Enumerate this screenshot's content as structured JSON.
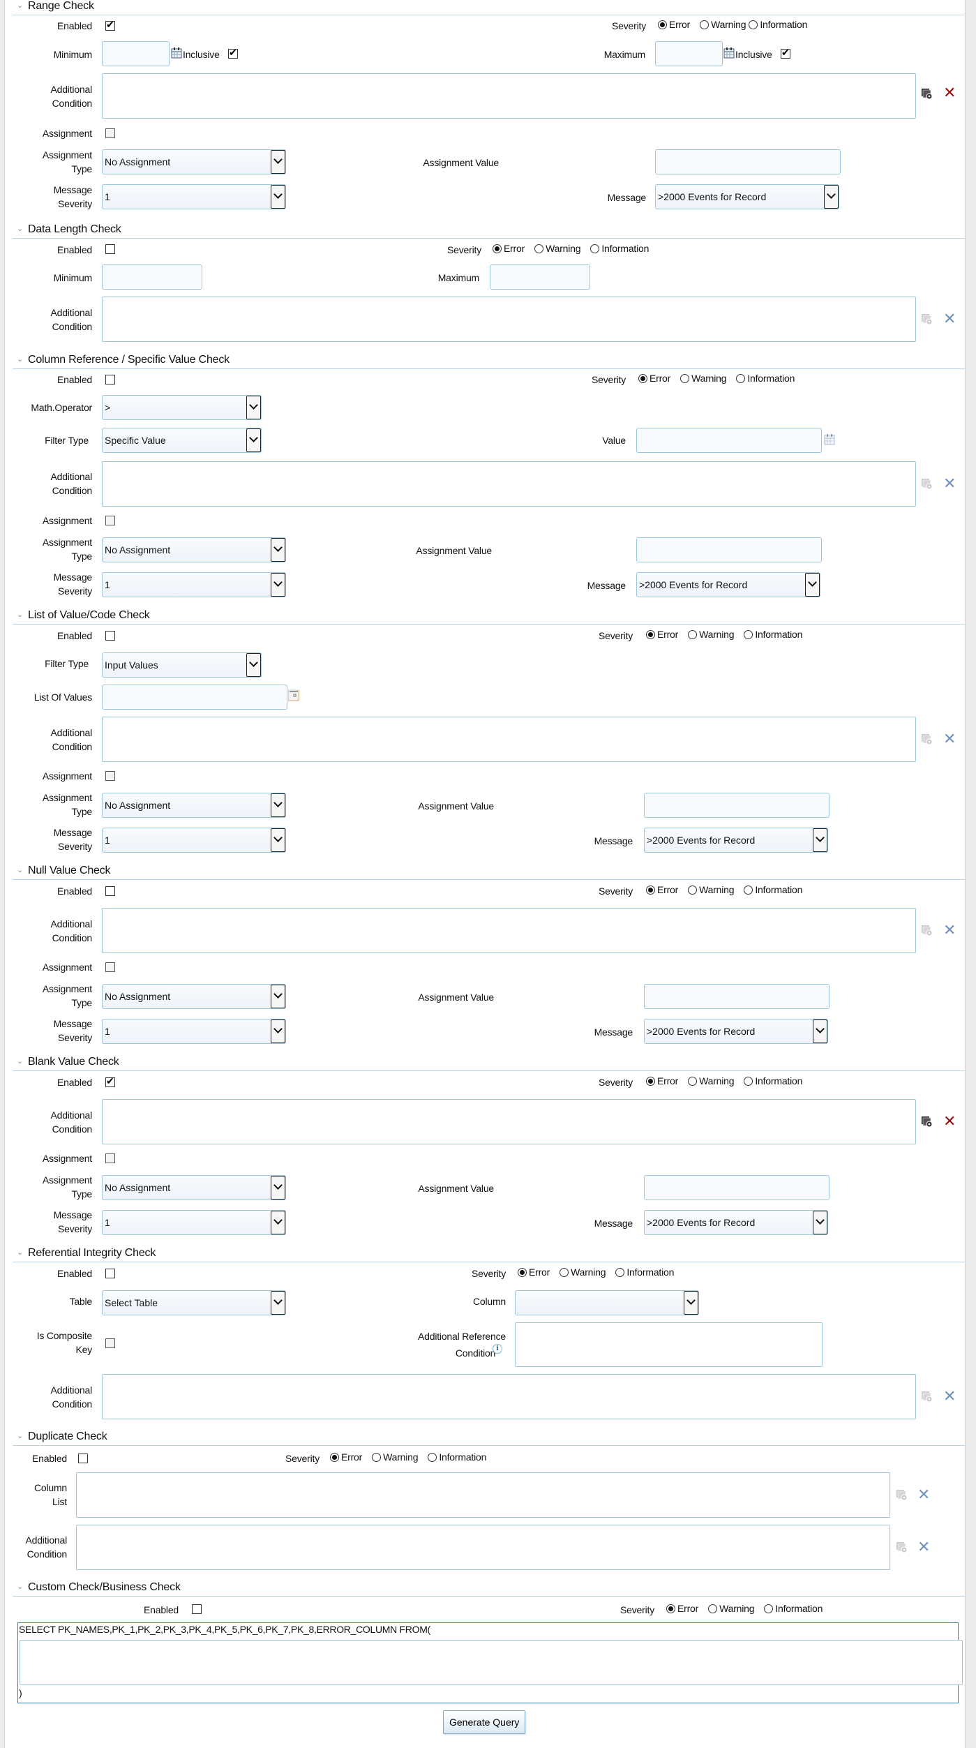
{
  "common": {
    "enabled": "Enabled",
    "severity": "Severity",
    "sev_error": "Error",
    "sev_warning": "Warning",
    "sev_information": "Information",
    "minimum": "Minimum",
    "maximum": "Maximum",
    "inclusive": "Inclusive",
    "additional": "Additional",
    "condition": "Condition",
    "assignment": "Assignment",
    "assignment_type_1": "Assignment",
    "assignment_type_2": "Type",
    "assignment_value": "Assignment Value",
    "message_severity_1": "Message",
    "message_severity_2": "Severity",
    "message": "Message",
    "no_assignment": "No Assignment",
    "msg_severity_val": "1",
    "message_val": ">2000 Events for Record"
  },
  "sections": {
    "range": {
      "title": "Range Check",
      "enabled": true,
      "severity": "Error",
      "min_inclusive": true,
      "max_inclusive": true,
      "assignment": false
    },
    "data_length": {
      "title": "Data Length Check",
      "enabled": false,
      "severity": "Error"
    },
    "column_ref": {
      "title": "Column Reference / Specific Value Check",
      "enabled": false,
      "severity": "Error",
      "math_operator_label": "Math.Operator",
      "math_operator_val": ">",
      "filter_type_label": "Filter Type",
      "filter_type_val": "Specific Value",
      "value_label": "Value",
      "assignment": false
    },
    "lov": {
      "title": "List of Value/Code Check",
      "enabled": false,
      "severity": "Error",
      "filter_type_label": "Filter Type",
      "filter_type_val": "Input Values",
      "lov_label": "List Of Values",
      "assignment": false
    },
    "null_value": {
      "title": "Null Value Check",
      "enabled": false,
      "severity": "Error",
      "assignment": false
    },
    "blank_value": {
      "title": "Blank Value Check",
      "enabled": true,
      "severity": "Error",
      "assignment": false
    },
    "ref_integrity": {
      "title": "Referential Integrity Check",
      "enabled": false,
      "severity": "Error",
      "table_label": "Table",
      "table_val": "Select Table",
      "column_label": "Column",
      "column_val": "",
      "composite_1": "Is Composite",
      "composite_2": "Key",
      "add_ref_1": "Additional Reference",
      "add_ref_2": "Condition",
      "is_composite": false
    },
    "duplicate": {
      "title": "Duplicate Check",
      "enabled": false,
      "severity": "Error",
      "column_list_1": "Column",
      "column_list_2": "List"
    },
    "custom": {
      "title": "Custom Check/Business Check",
      "enabled": false,
      "severity": "Error",
      "sql_prefix": "SELECT PK_NAMES,PK_1,PK_2,PK_3,PK_4,PK_5,PK_6,PK_7,PK_8,ERROR_COLUMN FROM(",
      "sql_suffix": ")",
      "generate_query": "Generate Query"
    }
  },
  "icons": {
    "section_toggle": "chevron-down-icon",
    "expression_builder": "expression-builder-icon",
    "clear": "close-icon",
    "calendar": "calendar-icon",
    "info": "info-icon"
  },
  "colors": {
    "border": "#9cc7de",
    "divider": "#b7d5e6",
    "clear_active": "#9a0f0f",
    "clear_inactive": "#6f93bd",
    "sql_border": "#3b7bbf"
  }
}
